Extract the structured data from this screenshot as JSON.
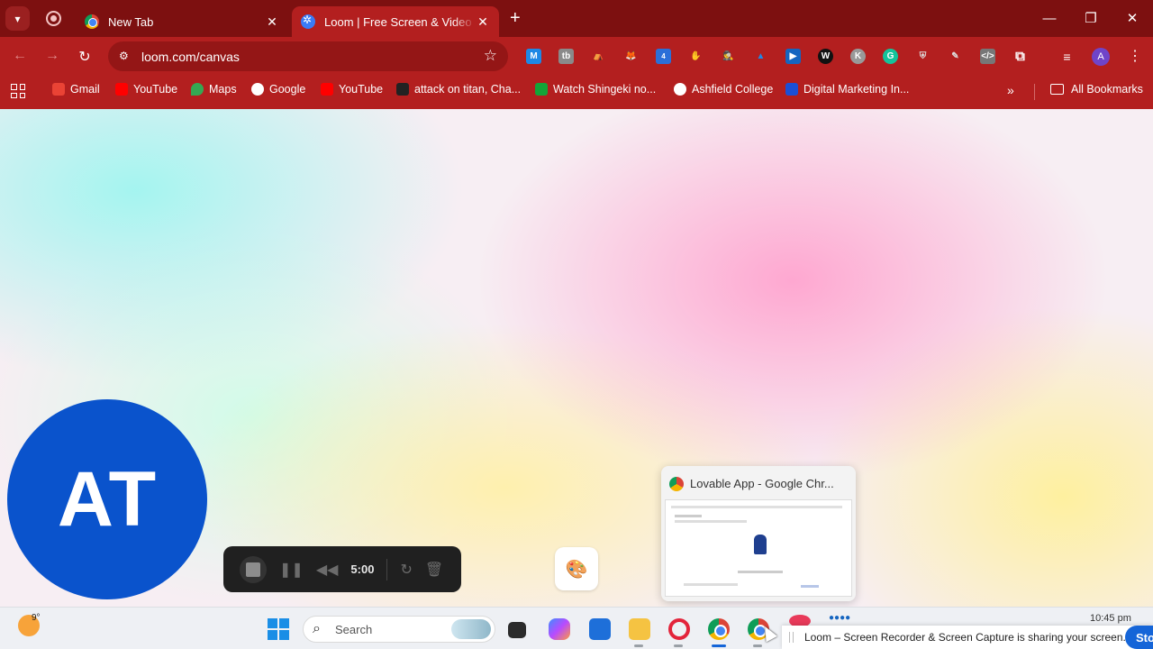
{
  "browser": {
    "tabs": [
      {
        "title": "New Tab",
        "active": false
      },
      {
        "title": "Loom | Free Screen & Video Recording",
        "active": true
      }
    ],
    "url": "loom.com/canvas",
    "profile_initial": "A",
    "extension_badge": "4",
    "bookmarks": [
      {
        "label": "Gmail",
        "color": "#ea4335"
      },
      {
        "label": "YouTube",
        "color": "#ff0000"
      },
      {
        "label": "Maps",
        "color": "#34a853"
      },
      {
        "label": "Google",
        "color": "#4285f4"
      },
      {
        "label": "YouTube",
        "color": "#ff0000"
      },
      {
        "label": "attack on titan, Cha...",
        "color": "#222222"
      },
      {
        "label": "Watch Shingeki no...",
        "color": "#13a538"
      },
      {
        "label": "Ashfield College",
        "color": "#ffffff"
      },
      {
        "label": "Digital Marketing In...",
        "color": "#1b4fd6"
      }
    ],
    "all_bookmarks_label": "All Bookmarks"
  },
  "loom": {
    "camera_initials": "AT",
    "timer": "5:00",
    "preview_title": "Lovable App - Google Chr..."
  },
  "taskbar": {
    "temperature": "9°",
    "search_placeholder": "Search",
    "clock": "10:45 pm",
    "share_message": "Loom – Screen Recorder & Screen Capture is sharing your screen.",
    "stop_label": "Stop"
  },
  "colors": {
    "tabstrip": "#7d1010",
    "toolbar": "#b31f1f",
    "camera_bubble": "#0a53cc",
    "stop_sharing": "#1565d8"
  }
}
